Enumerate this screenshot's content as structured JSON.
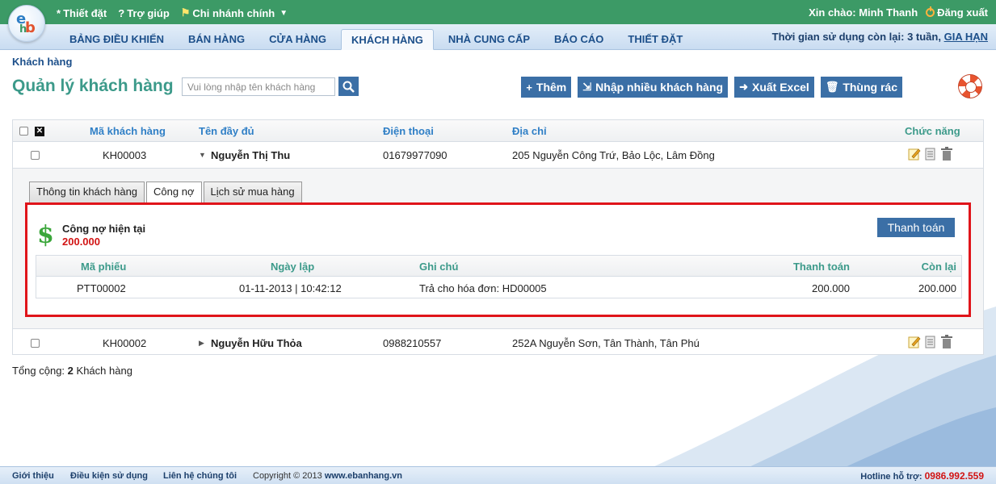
{
  "top": {
    "links": [
      {
        "label": "Thiết đặt",
        "icon": "star-icon"
      },
      {
        "label": "Trợ giúp",
        "icon": "question-icon"
      },
      {
        "label": "Chi nhánh chính",
        "icon": "flag-icon"
      }
    ],
    "greeting": "Xin chào: Minh Thanh",
    "logout": "Đăng xuất"
  },
  "nav": {
    "tabs": [
      "BẢNG ĐIỀU KHIỂN",
      "BÁN HÀNG",
      "CỬA HÀNG",
      "KHÁCH HÀNG",
      "NHÀ CUNG CẤP",
      "BÁO CÁO",
      "THIẾT ĐẶT"
    ],
    "active": "KHÁCH HÀNG",
    "remaining": "Thời gian sử dụng còn lại: 3 tuần,",
    "extend": "GIA HẠN"
  },
  "breadcrumb": "Khách hàng",
  "title": "Quản lý khách hàng",
  "search": {
    "placeholder": "Vui lòng nhập tên khách hàng"
  },
  "actions": {
    "add": "Thêm",
    "import": "Nhập nhiều khách hàng",
    "export": "Xuất Excel",
    "trash": "Thùng rác"
  },
  "table": {
    "headers": {
      "code": "Mã khách hàng",
      "name": "Tên đầy đủ",
      "phone": "Điện thoại",
      "address": "Địa chỉ",
      "functions": "Chức năng"
    },
    "rows": [
      {
        "code": "KH00003",
        "name": "Nguyễn Thị Thu",
        "phone": "01679977090",
        "address": "205 Nguyễn Công Trứ, Bảo Lộc, Lâm Đồng"
      },
      {
        "code": "KH00002",
        "name": "Nguyễn Hữu Thỏa",
        "phone": "0988210557",
        "address": "252A Nguyễn Sơn, Tân Thành, Tân Phú"
      }
    ]
  },
  "detail": {
    "tabs": [
      "Thông tin khách hàng",
      "Công nợ",
      "Lịch sử mua hàng"
    ],
    "active_tab": "Công nợ",
    "debt_label": "Công nợ hiện tại",
    "debt_value": "200.000",
    "pay_button": "Thanh toán",
    "headers": {
      "voucher": "Mã phiếu",
      "date": "Ngày lập",
      "note": "Ghi chú",
      "paid": "Thanh toán",
      "remain": "Còn lại"
    },
    "rows": [
      {
        "voucher": "PTT00002",
        "date": "01-11-2013 | 10:42:12",
        "note": "Trả cho hóa đơn: HD00005",
        "paid": "200.000",
        "remain": "200.000"
      }
    ]
  },
  "total": {
    "label": "Tổng cộng:",
    "count": "2",
    "unit": "Khách hàng"
  },
  "footer": {
    "links": [
      "Giới thiệu",
      "Điều kiện sử dụng",
      "Liên hệ chúng tôi"
    ],
    "copyright": "Copyright © 2013",
    "site": "www.ebanhang.vn",
    "hotline_label": "Hotline hỗ trợ:",
    "hotline": "0986.992.559"
  }
}
